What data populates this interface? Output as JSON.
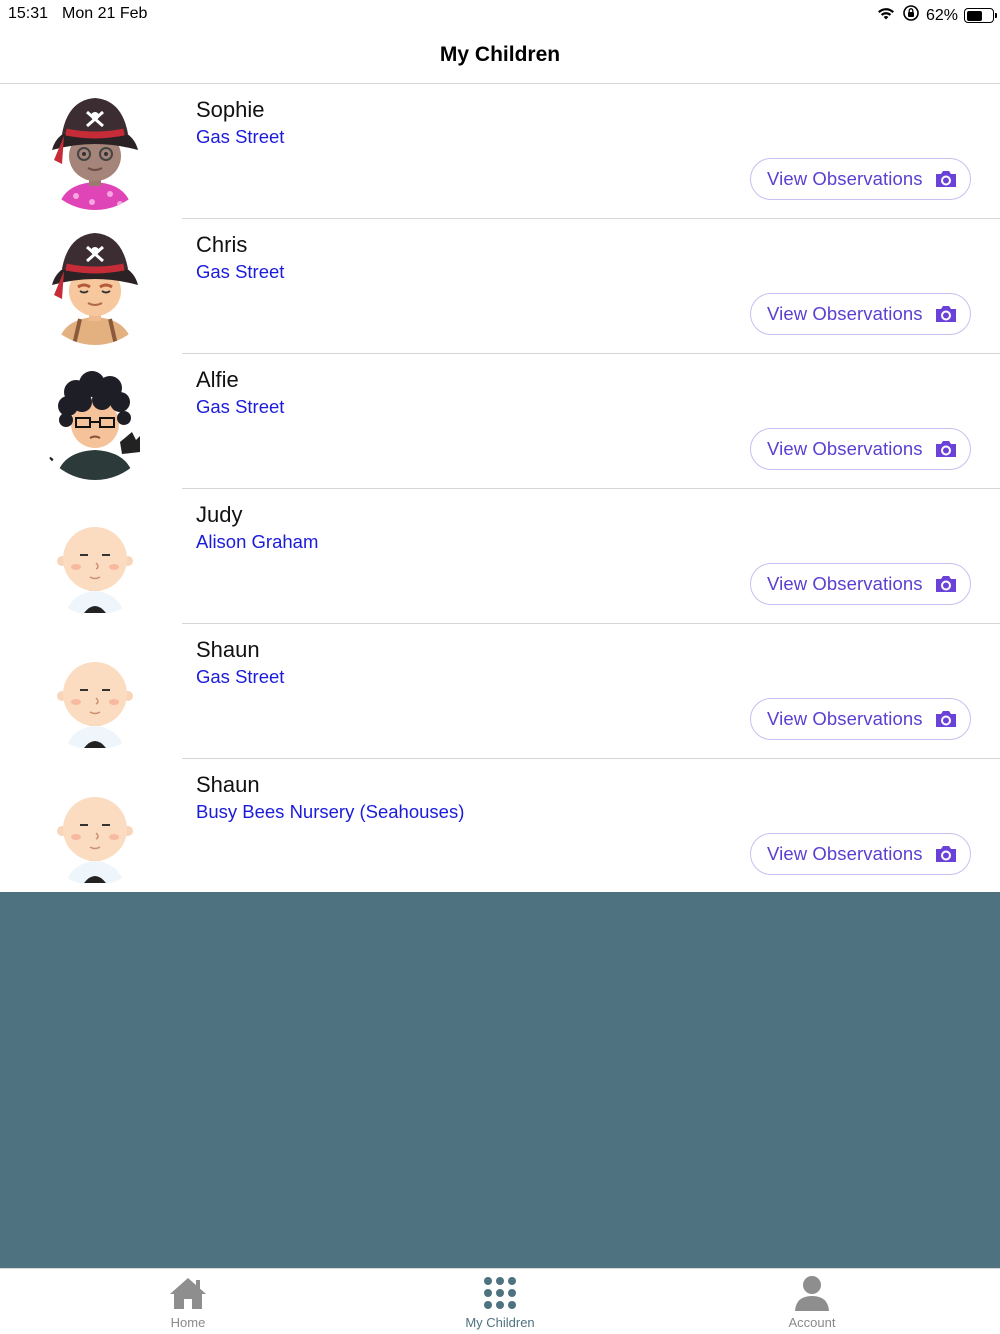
{
  "status_bar": {
    "time": "15:31",
    "date": "Mon 21 Feb",
    "battery_percent_label": "62%",
    "battery_level": 0.62
  },
  "header": {
    "title": "My Children"
  },
  "children": [
    {
      "name": "Sophie",
      "location": "Gas Street",
      "button_label": "View Observations",
      "avatar": "pirate-girl-avatar"
    },
    {
      "name": "Chris",
      "location": "Gas Street",
      "button_label": "View Observations",
      "avatar": "pirate-boy-avatar"
    },
    {
      "name": "Alfie",
      "location": "Gas Street",
      "button_label": "View Observations",
      "avatar": "curly-hair-glasses-avatar"
    },
    {
      "name": "Judy",
      "location": "Alison Graham",
      "button_label": "View Observations",
      "avatar": "default-baby-avatar"
    },
    {
      "name": "Shaun",
      "location": "Gas Street",
      "button_label": "View Observations",
      "avatar": "default-baby-avatar"
    },
    {
      "name": "Shaun",
      "location": "Busy Bees Nursery (Seahouses)",
      "button_label": "View Observations",
      "avatar": "default-baby-avatar"
    }
  ],
  "tab_bar": {
    "tabs": [
      {
        "label": "Home",
        "icon": "home-icon"
      },
      {
        "label": "My Children",
        "icon": "grid-dots-icon",
        "active": true
      },
      {
        "label": "Account",
        "icon": "person-icon"
      }
    ]
  },
  "colors": {
    "accent": "#5b3fd1",
    "location_link": "#1b1bdb",
    "background_slate": "#4e7280",
    "divider": "#d6d6d6"
  }
}
